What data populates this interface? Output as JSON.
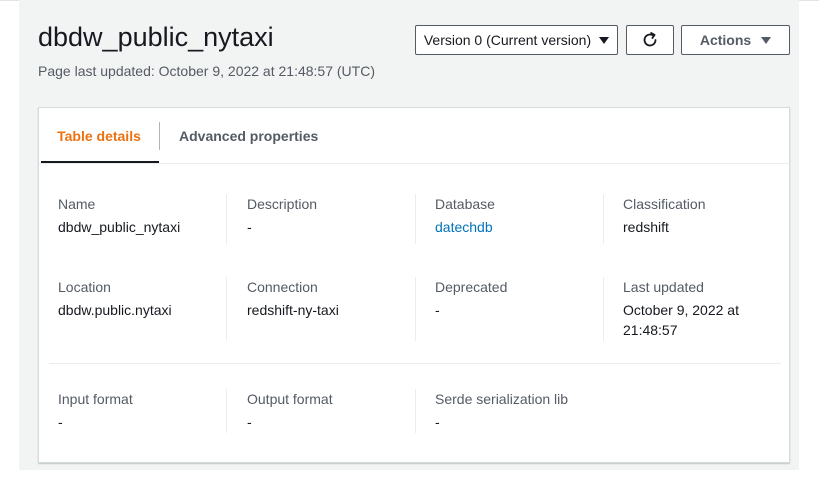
{
  "header": {
    "title": "dbdw_public_nytaxi",
    "subtitle": "Page last updated: October 9, 2022 at 21:48:57 (UTC)"
  },
  "toolbar": {
    "version_label": "Version 0 (Current version)",
    "actions_label": "Actions"
  },
  "tabs": [
    {
      "label": "Table details",
      "active": true
    },
    {
      "label": "Advanced properties",
      "active": false
    }
  ],
  "details": {
    "name": {
      "label": "Name",
      "value": "dbdw_public_nytaxi"
    },
    "description": {
      "label": "Description",
      "value": "-"
    },
    "database": {
      "label": "Database",
      "value": "datechdb"
    },
    "classification": {
      "label": "Classification",
      "value": "redshift"
    },
    "location": {
      "label": "Location",
      "value": "dbdw.public.nytaxi"
    },
    "connection": {
      "label": "Connection",
      "value": "redshift-ny-taxi"
    },
    "deprecated": {
      "label": "Deprecated",
      "value": "-"
    },
    "last_updated": {
      "label": "Last updated",
      "value": "October 9, 2022 at 21:48:57"
    },
    "input_format": {
      "label": "Input format",
      "value": "-"
    },
    "output_format": {
      "label": "Output format",
      "value": "-"
    },
    "serde_lib": {
      "label": "Serde serialization lib",
      "value": "-"
    }
  },
  "colors": {
    "accent": "#ec7211",
    "link": "#0073bb",
    "text": "#16191f",
    "secondary_text": "#545b64",
    "page_bg": "#f2f3f3"
  },
  "icons": {
    "refresh": "refresh-icon",
    "dropdown": "caret-down-icon"
  }
}
